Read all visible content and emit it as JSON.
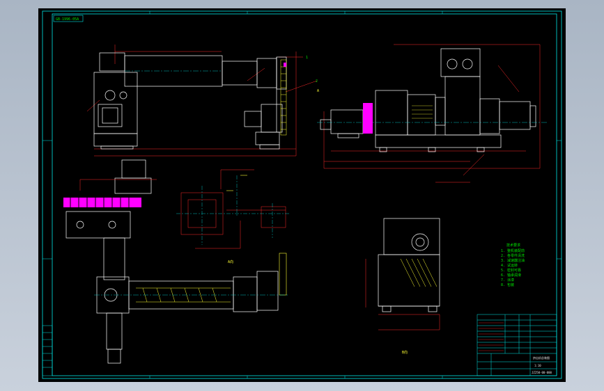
{
  "frame": {
    "corner_tag": "GB-1996-05A",
    "view_label_mid": "A向",
    "view_label_right": "B向",
    "callouts": [
      "1",
      "2",
      "A"
    ]
  },
  "tech_notes": {
    "heading": "技术要求",
    "lines": [
      "1. 整机装配前",
      "2. 各零件清洗",
      "3. 减速器注油",
      "4. 试运转",
      "5. 密封可靠",
      "6. 轴承润滑",
      "7. 涂漆",
      "8. 包装"
    ]
  },
  "title_block": {
    "drawing_name": "挤出机总装图",
    "scale": "1:10",
    "sheet_code": "JZ250-00-000"
  },
  "colors": {
    "frame": "#00e5e5",
    "outline": "#ffffff",
    "dimension": "#ff2a2a",
    "center": "#00e5e5",
    "hatch": "#ffff33",
    "highlight": "#ff00ff",
    "text": "#00e600"
  }
}
